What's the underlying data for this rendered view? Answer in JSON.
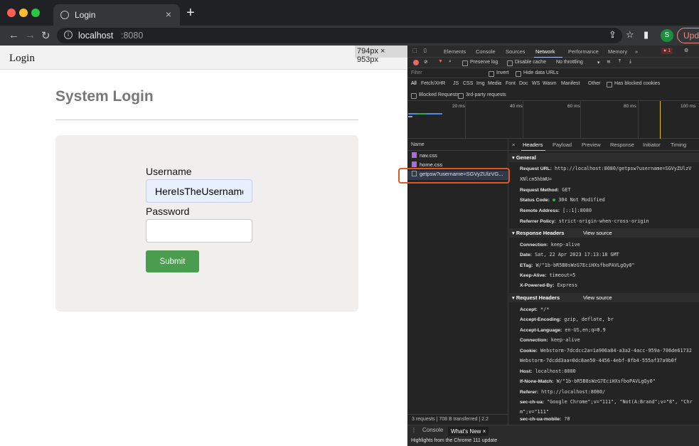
{
  "browser": {
    "tab_title": "Login",
    "tab_close": "×",
    "new_tab": "+",
    "url_host": "localhost",
    "url_port": ":8080",
    "profile_initial": "S",
    "update_label": "Update"
  },
  "page": {
    "viewport_size": "794px × 953px",
    "nav_brand": "Login",
    "title": "System Login",
    "username_label": "Username",
    "username_value": "HereIsTheUsername",
    "password_label": "Password",
    "password_value": "",
    "submit_label": "Submit"
  },
  "devtools": {
    "tabs": [
      "Elements",
      "Console",
      "Sources",
      "Network",
      "Performance",
      "Memory",
      "»"
    ],
    "active_tab": "Network",
    "error_count": "1",
    "preserve_log": "Preserve log",
    "disable_cache": "Disable cache",
    "throttling": "No throttling",
    "filter_placeholder": "Filter",
    "invert": "Invert",
    "hide_data_urls": "Hide data URLs",
    "type_filters": [
      "All",
      "Fetch/XHR",
      "JS",
      "CSS",
      "Img",
      "Media",
      "Font",
      "Doc",
      "WS",
      "Wasm",
      "Manifest",
      "Other"
    ],
    "has_blocked_cookies": "Has blocked cookies",
    "blocked_requests": "Blocked Requests",
    "third_party": "3rd-party requests",
    "timeline_ticks": [
      "20 ms",
      "40 ms",
      "60 ms",
      "80 ms",
      "100 ms"
    ],
    "name_header": "Name",
    "requests": [
      "nav.css",
      "home.css",
      "getpsw?username=SGVyZUlzVG..."
    ],
    "footer": "3 requests | 708 B transferred | 2.2",
    "detail_tabs": [
      "Headers",
      "Payload",
      "Preview",
      "Response",
      "Initiator",
      "Timing"
    ],
    "active_detail_tab": "Headers",
    "general_title": "▾ General",
    "request_url_label": "Request URL:",
    "request_url_value": "http://localhost:8080/getpsw?username=SGVyZUlzV",
    "request_url_cont": "XNlcm5hbWU=",
    "request_method_label": "Request Method:",
    "request_method_value": "GET",
    "status_code_label": "Status Code:",
    "status_code_value": "304 Not Modified",
    "remote_address_label": "Remote Address:",
    "remote_address_value": "[::1]:8080",
    "referrer_policy_label": "Referrer Policy:",
    "referrer_policy_value": "strict-origin-when-cross-origin",
    "response_headers_title": "▾ Response Headers",
    "view_source": "View source",
    "connection_label": "Connection:",
    "connection_value": "keep-alive",
    "date_label": "Date:",
    "date_value": "Sat, 22 Apr 2023 17:13:18 GMT",
    "etag_label": "ETag:",
    "etag_value": "W/\"1b-bR5B8sWzG7EciHXsfboPAVLgQy0\"",
    "keepalive_label": "Keep-Alive:",
    "keepalive_value": "timeout=5",
    "poweredby_label": "X-Powered-By:",
    "poweredby_value": "Express",
    "request_headers_title": "▾ Request Headers",
    "accept_label": "Accept:",
    "accept_value": "*/*",
    "accept_encoding_label": "Accept-Encoding:",
    "accept_encoding_value": "gzip, deflate, br",
    "accept_language_label": "Accept-Language:",
    "accept_language_value": "en-US,en;q=0.9",
    "req_connection_label": "Connection:",
    "req_connection_value": "keep-alive",
    "cookie_label": "Cookie:",
    "cookie_value": "Webstorm-7dcdcc2a=1a906a84-a3a2-4acc-959a-706de61732",
    "cookie_cont": "Webstorm-7dcdd3aa=0dc8ae50-4456-4ebf-8fb4-555af37a9b0f",
    "host_label": "Host:",
    "host_value": "localhost:8080",
    "if_none_match_label": "If-None-Match:",
    "if_none_match_value": "W/\"1b-bR5B8sWzG7EciHXsfboPAVLgQy0\"",
    "referer_label": "Referer:",
    "referer_value": "http://localhost:8080/",
    "sec_ch_ua_label": "sec-ch-ua:",
    "sec_ch_ua_value": "\"Google Chrome\";v=\"111\", \"Not(A:Brand\";v=\"8\", \"Chr",
    "sec_ch_ua_cont": "m\";v=\"111\"",
    "sec_ch_ua_mobile_label": "sec-ch-ua-mobile:",
    "sec_ch_ua_mobile_value": "?0",
    "drawer_console": "Console",
    "drawer_whats_new": "What's New",
    "drawer_close": "×",
    "drawer_highlight": "Highlights from the Chrome 111 update"
  },
  "colors": {
    "accent": "#4a9d4f",
    "highlight": "#e5561c",
    "status_ok": "#34a853"
  }
}
